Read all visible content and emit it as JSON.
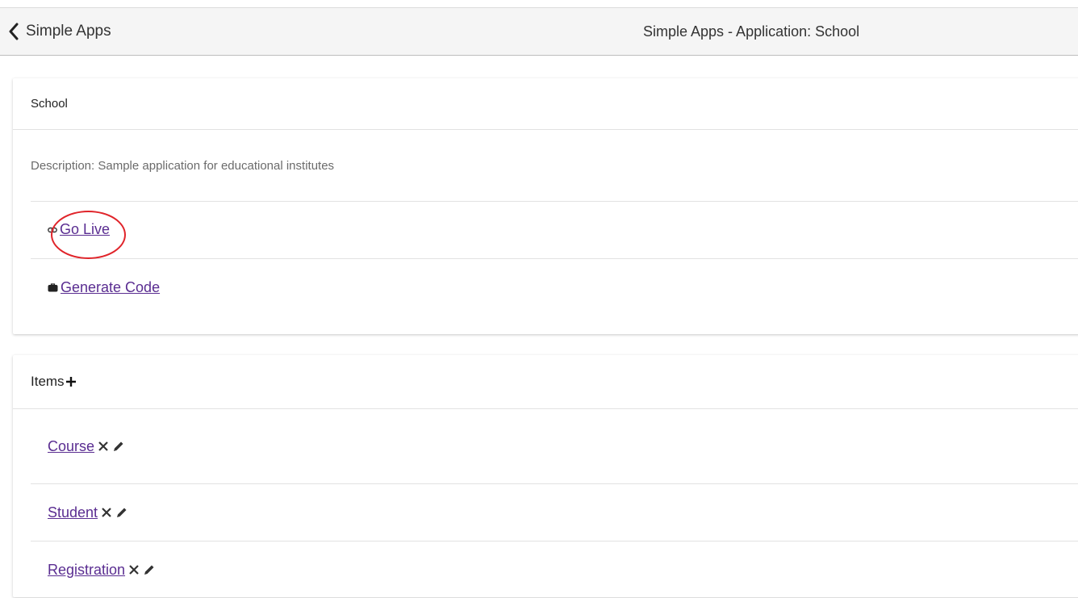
{
  "header": {
    "back_label": "Simple Apps",
    "title": "Simple Apps - Application: School"
  },
  "app_card": {
    "name": "School",
    "description": "Description: Sample application for educational institutes",
    "actions": [
      {
        "label": "Go Live",
        "icon": "link-icon"
      },
      {
        "label": "Generate Code",
        "icon": "briefcase-icon"
      }
    ]
  },
  "items_card": {
    "title": "Items",
    "add_icon": "plus-icon",
    "items": [
      {
        "label": "Course"
      },
      {
        "label": "Student"
      },
      {
        "label": "Registration"
      }
    ]
  },
  "colors": {
    "link": "#5a2d91",
    "annotation_circle": "#e0242a",
    "topbar_bg": "#f5f5f5"
  }
}
